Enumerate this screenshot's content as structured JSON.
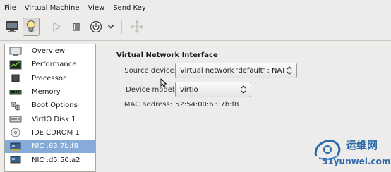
{
  "menubar": {
    "items": [
      "File",
      "Virtual Machine",
      "View",
      "Send Key"
    ]
  },
  "toolbar": {
    "buttons": [
      {
        "icon": "monitor-icon"
      },
      {
        "icon": "lightbulb-info-icon",
        "active": true
      },
      {
        "icon": "play-icon",
        "disabled": true
      },
      {
        "icon": "pause-icon"
      },
      {
        "icon": "power-icon"
      },
      {
        "icon": "chevron-down-icon"
      },
      {
        "icon": "move-arrows-icon",
        "disabled": true
      }
    ]
  },
  "sidebar": {
    "items": [
      {
        "label": "Overview",
        "icon": "overview-monitor-icon"
      },
      {
        "label": "Performance",
        "icon": "performance-graph-icon"
      },
      {
        "label": "Processor",
        "icon": "processor-chip-icon"
      },
      {
        "label": "Memory",
        "icon": "memory-module-icon"
      },
      {
        "label": "Boot Options",
        "icon": "gears-icon"
      },
      {
        "label": "VirtIO Disk 1",
        "icon": "disk-drive-icon"
      },
      {
        "label": "IDE CDROM 1",
        "icon": "cdrom-icon"
      },
      {
        "label": "NIC :63:7b:f8",
        "icon": "network-card-icon",
        "selected": true
      },
      {
        "label": "NIC :d5:50:a2",
        "icon": "network-card-icon"
      }
    ]
  },
  "main": {
    "section_title": "Virtual Network Interface",
    "source_device_label": "Source device:",
    "source_device_value": "Virtual network 'default' : NAT",
    "device_model_label": "Device model:",
    "device_model_value": "virtio",
    "mac_label": "MAC address:",
    "mac_value": "52:54:00:63:7b:f8"
  },
  "watermark": {
    "line1": "运维网",
    "line2": "51yunwei.com"
  },
  "colors": {
    "selection": "#86abd9",
    "window_bg": "#edeceb",
    "watermark": "#2d6aa9"
  }
}
